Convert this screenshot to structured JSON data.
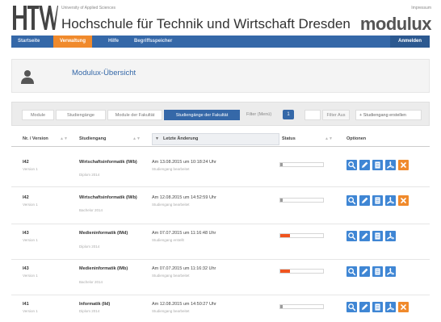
{
  "header": {
    "university_tagline": "University of Applied Sciences",
    "university_name": "Hochschule für Technik und Wirtschaft Dresden",
    "impressum": "Impressum",
    "app_logo": "modulux",
    "brand_color": "#3568a8",
    "accent_color": "#f08a2c"
  },
  "navbar": {
    "items": [
      {
        "label": "Startseite",
        "active": false
      },
      {
        "label": "Verwaltung",
        "active": true
      },
      {
        "label": "Hilfe",
        "active": false
      },
      {
        "label": "Begriffsspeicher",
        "active": false
      }
    ],
    "login_label": "Anmelden"
  },
  "overview": {
    "icon": "user-icon",
    "title": "Modulux-Übersicht"
  },
  "tabs": {
    "items": [
      {
        "label": "Module",
        "active": false
      },
      {
        "label": "Studiengänge",
        "active": false
      },
      {
        "label": "Module der Fakultät",
        "active": false
      },
      {
        "label": "Studiengänge der Fakultät",
        "active": true
      }
    ],
    "filter_label": "Filter (Menü)",
    "filter_count": "1",
    "filter_input_value": "",
    "filter_button": "Filter Aus",
    "create_button": "Studiengang erstellen"
  },
  "table": {
    "columns": [
      "Nr. / Version",
      "Studiengang",
      "Letzte Änderung",
      "Status",
      "Optionen"
    ],
    "rows": [
      {
        "nr": "I42",
        "version": "Version 1",
        "name": "Wirtschaftsinformatik (IWb)",
        "name_sub": "Diplom 2014",
        "date": "Am 13.08.2015 um 10:18:24 Uhr",
        "date_sub": "Studiengang bearbeitet",
        "status_fill": 0.06,
        "status_color": "#9a9a9a",
        "actions": [
          "search-icon",
          "edit-icon",
          "document-icon",
          "pdf-icon",
          "delete-icon"
        ]
      },
      {
        "nr": "I42",
        "version": "Version 1",
        "name": "Wirtschaftsinformatik (IWb)",
        "name_sub": "Bachelor 2014",
        "date": "Am 12.08.2015 um 14:52:59 Uhr",
        "date_sub": "Studiengang bearbeitet",
        "status_fill": 0.06,
        "status_color": "#9a9a9a",
        "actions": [
          "search-icon",
          "edit-icon",
          "document-icon",
          "pdf-icon",
          "delete-icon"
        ]
      },
      {
        "nr": "I43",
        "version": "Version 1",
        "name": "Medieninformatik (IMd)",
        "name_sub": "Diplom 2014",
        "date": "Am 07.07.2015 um 11:16:48 Uhr",
        "date_sub": "Studiengang erstellt",
        "status_fill": 0.22,
        "status_color": "#f0541e",
        "actions": [
          "search-icon",
          "edit-icon",
          "document-icon",
          "pdf-icon"
        ]
      },
      {
        "nr": "I43",
        "version": "Version 1",
        "name": "Medieninformatik (IMb)",
        "name_sub": "Bachelor 2014",
        "date": "Am 07.07.2015 um 11:16:32 Uhr",
        "date_sub": "Studiengang bearbeitet",
        "status_fill": 0.22,
        "status_color": "#f0541e",
        "actions": [
          "search-icon",
          "edit-icon",
          "document-icon",
          "pdf-icon"
        ]
      },
      {
        "nr": "I41",
        "version": "Version 1",
        "name": "Informatik (IId)",
        "name_sub": "Diplom 2014",
        "date": "Am 12.08.2015 um 14:50:27 Uhr",
        "date_sub": "Studiengang bearbeitet",
        "status_fill": 0.06,
        "status_color": "#9a9a9a",
        "actions": [
          "search-icon",
          "edit-icon",
          "document-icon",
          "pdf-icon",
          "delete-icon"
        ]
      }
    ]
  }
}
